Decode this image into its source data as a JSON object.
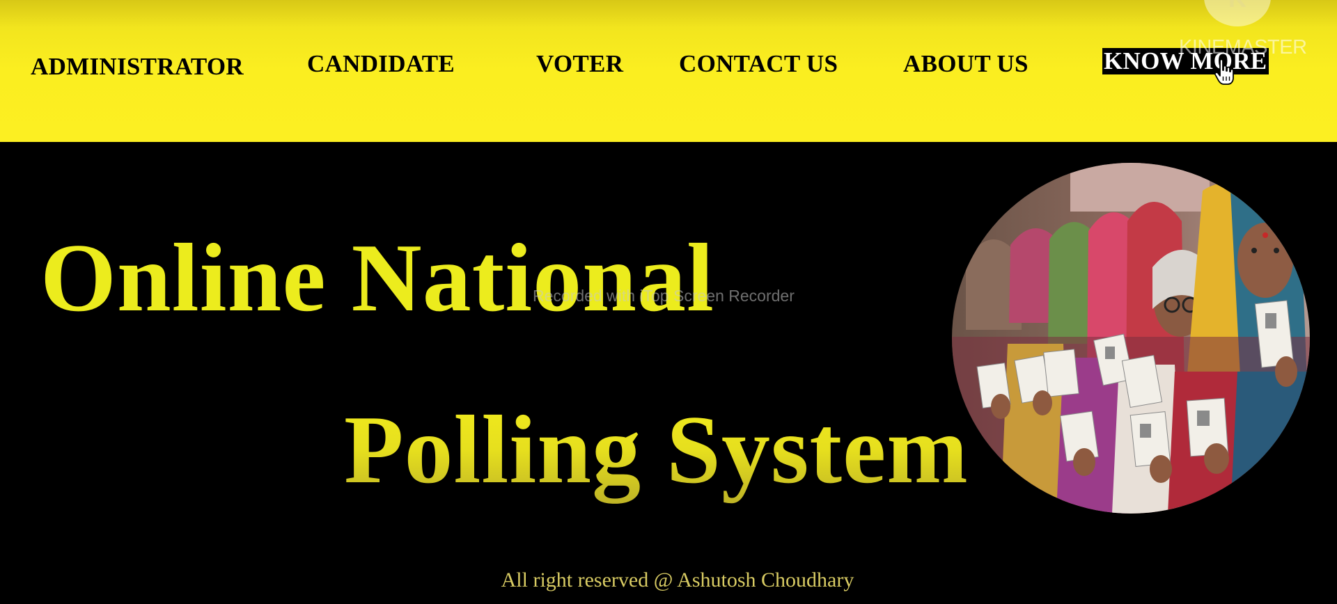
{
  "nav": {
    "items": [
      {
        "label": "ADMINISTRATOR"
      },
      {
        "label": "CANDIDATE"
      },
      {
        "label": "VOTER"
      },
      {
        "label": "CONTACT US"
      },
      {
        "label": "ABOUT US"
      },
      {
        "label": "KNOW MORE"
      }
    ],
    "active_index": 5
  },
  "hero": {
    "title_line1": "Online National",
    "title_line2": "Polling System",
    "image_alt": "voters-holding-id-cards"
  },
  "footer": {
    "text": "All right reserved @ Ashutosh Choudhary"
  },
  "overlays": {
    "recorder_watermark": "Recorded with iTop Screen Recorder",
    "kinemaster_watermark": "KINEMASTER"
  },
  "colors": {
    "nav_background": "#fcef22",
    "page_background": "#000000",
    "hero_text": "#ecec1d",
    "footer_text": "#d8cb63",
    "active_nav_bg": "#000000",
    "active_nav_text": "#ffffff"
  },
  "icons": {
    "cursor": "hand-pointer-icon",
    "watermark_logo": "kinemaster-logo-icon"
  }
}
